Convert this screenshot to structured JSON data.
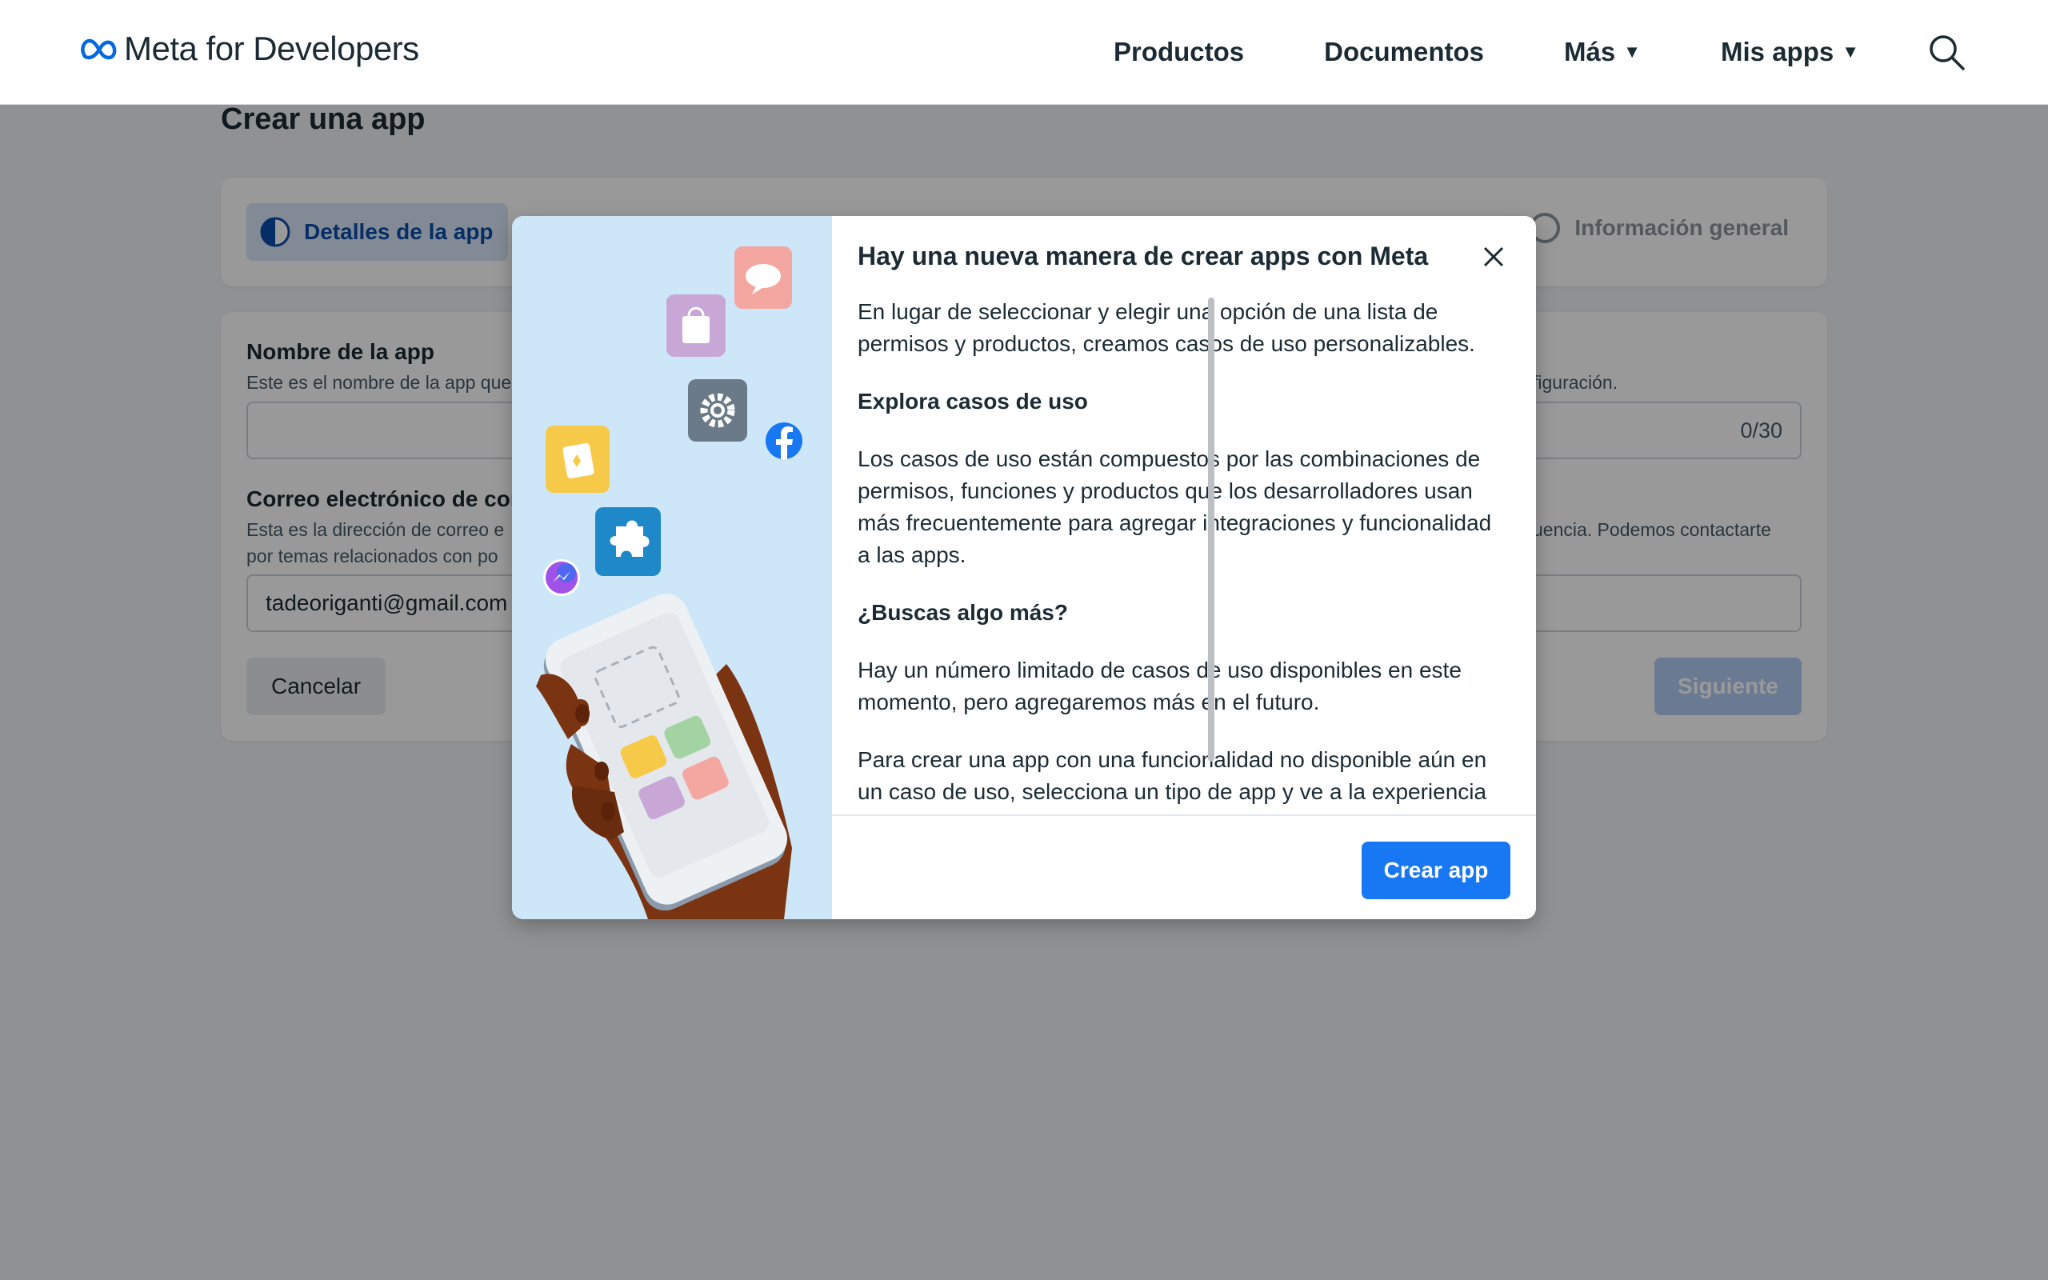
{
  "header": {
    "logo_text": "Meta for Developers",
    "nav": [
      {
        "label": "Productos",
        "has_caret": false
      },
      {
        "label": "Documentos",
        "has_caret": false
      },
      {
        "label": "Más",
        "has_caret": true
      },
      {
        "label": "Mis apps",
        "has_caret": true
      }
    ],
    "caret_glyph": "▼",
    "search_icon": "search-icon"
  },
  "page": {
    "title": "Crear una app",
    "steps": {
      "active_label": "Detalles de la app",
      "last_label": "Información general"
    },
    "form": {
      "name_label": "Nombre de la app",
      "name_help_left": "Este es el nombre de la app que",
      "name_help_right": "figuración.",
      "name_value": "",
      "name_counter": "0/30",
      "email_label": "Correo electrónico de cont",
      "email_help_left_1": "Esta es la dirección de correo e",
      "email_help_left_2": "por temas relacionados con po",
      "email_help_right": "uencia. Podemos contactarte",
      "email_value": "tadeoriganti@gmail.com",
      "cancel_label": "Cancelar",
      "next_label": "Siguiente"
    }
  },
  "modal": {
    "title": "Hay una nueva manera de crear apps con Meta",
    "paragraphs": {
      "p1": "En lugar de seleccionar y elegir una opción de una lista de permisos y productos, creamos casos de uso personalizables.",
      "h1": "Explora casos de uso",
      "p2": "Los casos de uso están compuestos por las combinaciones de permisos, funciones y productos que los desarrolladores usan más frecuentemente para agregar integraciones y funcionalidad a las apps.",
      "h2": "¿Buscas algo más?",
      "p3": "Hay un número limitado de casos de uso disponibles en este momento, pero agregaremos más en el futuro.",
      "p4": "Para crear una app con una funcionalidad no disponible aún en un caso de uso, selecciona un tipo de app y ve a la experiencia"
    },
    "primary_button": "Crear app",
    "close_icon": "close-icon"
  },
  "colors": {
    "brand_blue": "#1877f2",
    "meta_blue": "#0668e1",
    "illustration_bg": "#cde6f8"
  }
}
